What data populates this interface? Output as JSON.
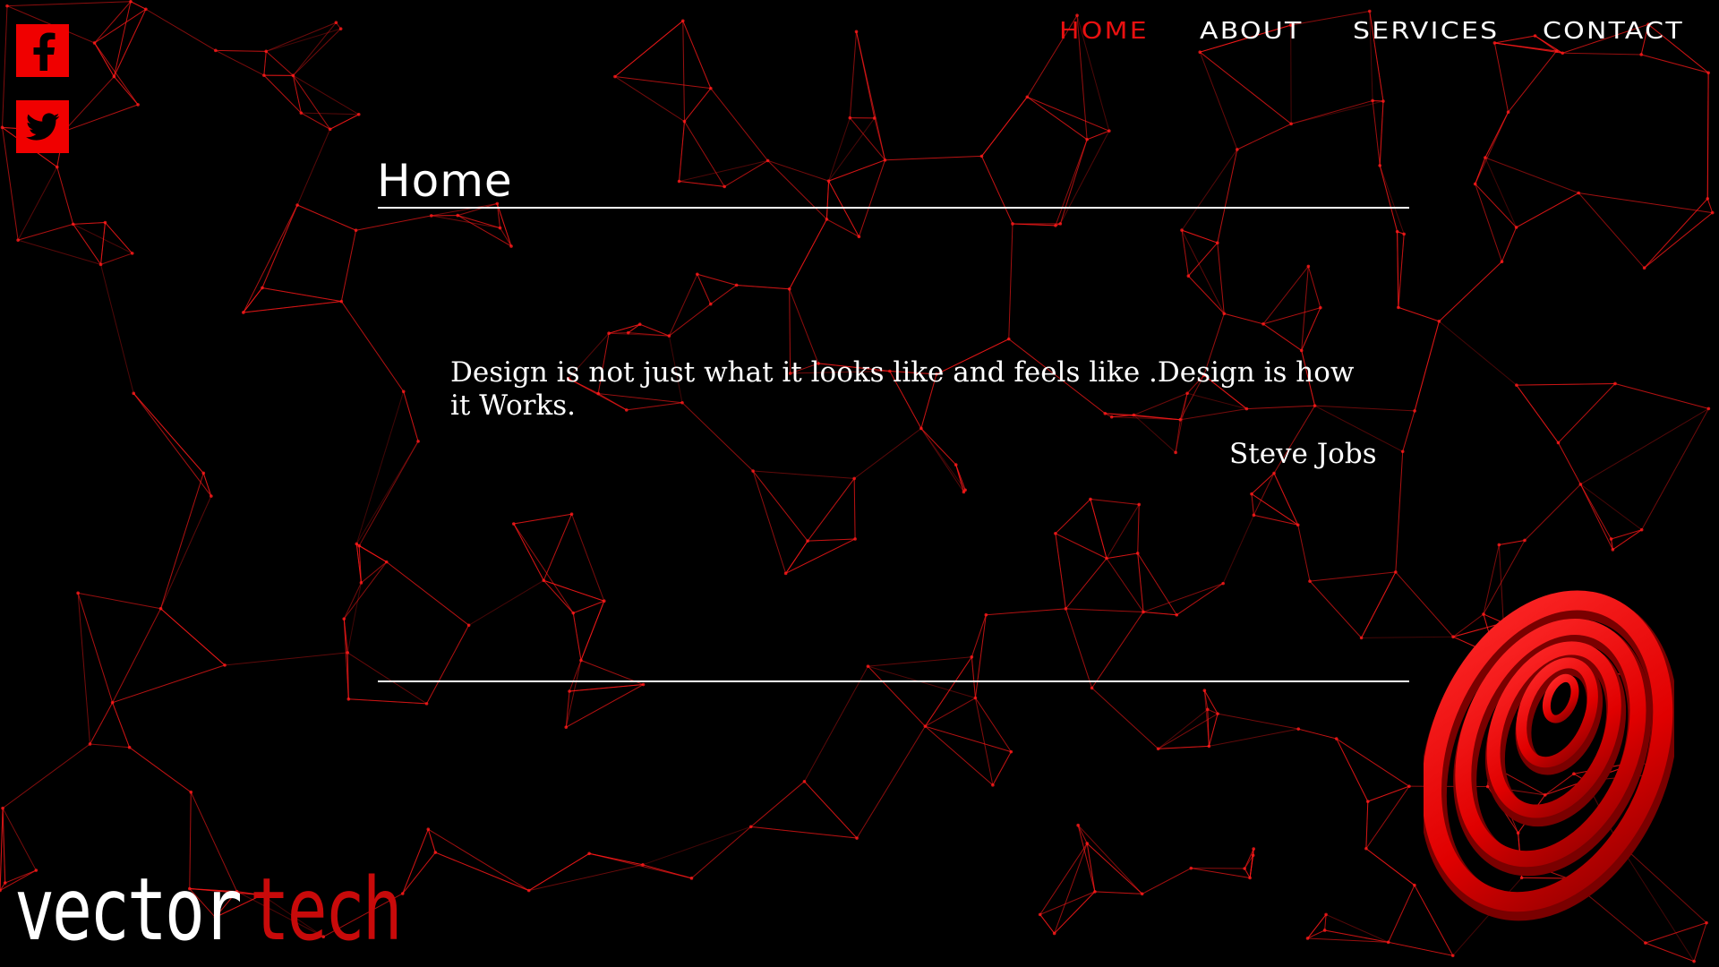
{
  "nav": {
    "items": [
      {
        "label": "HOME",
        "active": true
      },
      {
        "label": "ABOUT",
        "active": false
      },
      {
        "label": "SERVICES",
        "active": false
      },
      {
        "label": "CONTACT",
        "active": false
      }
    ]
  },
  "social": {
    "facebook_icon": "facebook-icon",
    "twitter_icon": "twitter-icon"
  },
  "page": {
    "title": "Home"
  },
  "quote": {
    "text": "Design is not just what it looks like and feels like .Design is how it Works.",
    "author": "Steve Jobs"
  },
  "logo": {
    "word1": "vector",
    "word2": "tech"
  },
  "colors": {
    "background": "#000000",
    "accent": "#e81010",
    "network_line": "#ff1a1a",
    "text": "#ffffff"
  }
}
